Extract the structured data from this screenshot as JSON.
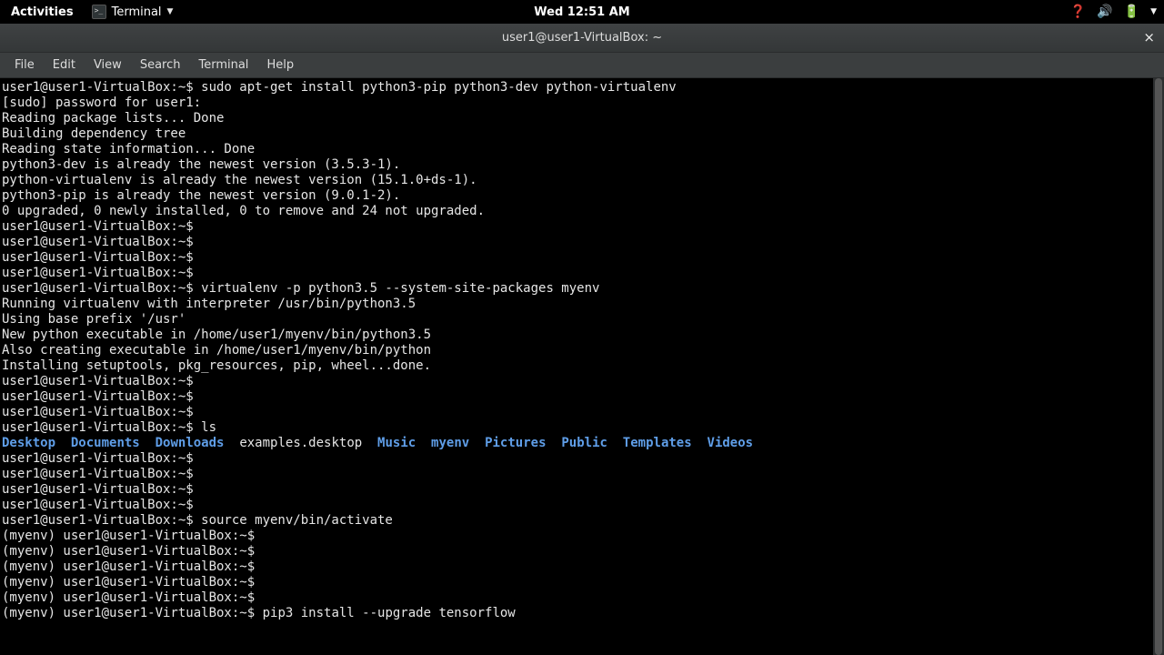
{
  "topbar": {
    "activities": "Activities",
    "app_label": "Terminal",
    "clock": "Wed 12:51 AM"
  },
  "window": {
    "title": "user1@user1-VirtualBox: ~"
  },
  "menubar": {
    "items": [
      "File",
      "Edit",
      "View",
      "Search",
      "Terminal",
      "Help"
    ]
  },
  "prompt": "user1@user1-VirtualBox:~$",
  "prompt_venv": "(myenv) user1@user1-VirtualBox:~$",
  "lines": [
    {
      "p": "prompt",
      "cmd": " sudo apt-get install python3-pip python3-dev python-virtualenv"
    },
    {
      "out": "[sudo] password for user1: "
    },
    {
      "out": "Reading package lists... Done"
    },
    {
      "out": "Building dependency tree"
    },
    {
      "out": "Reading state information... Done"
    },
    {
      "out": "python3-dev is already the newest version (3.5.3-1)."
    },
    {
      "out": "python-virtualenv is already the newest version (15.1.0+ds-1)."
    },
    {
      "out": "python3-pip is already the newest version (9.0.1-2)."
    },
    {
      "out": "0 upgraded, 0 newly installed, 0 to remove and 24 not upgraded."
    },
    {
      "p": "prompt",
      "cmd": " "
    },
    {
      "p": "prompt",
      "cmd": " "
    },
    {
      "p": "prompt",
      "cmd": " "
    },
    {
      "p": "prompt",
      "cmd": " "
    },
    {
      "p": "prompt",
      "cmd": " virtualenv -p python3.5 --system-site-packages myenv"
    },
    {
      "out": "Running virtualenv with interpreter /usr/bin/python3.5"
    },
    {
      "out": "Using base prefix '/usr'"
    },
    {
      "out": "New python executable in /home/user1/myenv/bin/python3.5"
    },
    {
      "out": "Also creating executable in /home/user1/myenv/bin/python"
    },
    {
      "out": "Installing setuptools, pkg_resources, pip, wheel...done."
    },
    {
      "p": "prompt",
      "cmd": " "
    },
    {
      "p": "prompt",
      "cmd": " "
    },
    {
      "p": "prompt",
      "cmd": " "
    },
    {
      "p": "prompt",
      "cmd": " ls"
    }
  ],
  "ls": {
    "entries": [
      {
        "name": "Desktop",
        "type": "dir"
      },
      {
        "name": "Documents",
        "type": "dir"
      },
      {
        "name": "Downloads",
        "type": "dir"
      },
      {
        "name": "examples.desktop",
        "type": "file"
      },
      {
        "name": "Music",
        "type": "dir"
      },
      {
        "name": "myenv",
        "type": "dir"
      },
      {
        "name": "Pictures",
        "type": "dir"
      },
      {
        "name": "Public",
        "type": "dir"
      },
      {
        "name": "Templates",
        "type": "dir"
      },
      {
        "name": "Videos",
        "type": "dir"
      }
    ]
  },
  "after_ls": [
    {
      "p": "prompt",
      "cmd": " "
    },
    {
      "p": "prompt",
      "cmd": " "
    },
    {
      "p": "prompt",
      "cmd": " "
    },
    {
      "p": "prompt",
      "cmd": " "
    },
    {
      "p": "prompt",
      "cmd": " source myenv/bin/activate"
    },
    {
      "p": "prompt_venv",
      "cmd": " "
    },
    {
      "p": "prompt_venv",
      "cmd": " "
    },
    {
      "p": "prompt_venv",
      "cmd": " "
    },
    {
      "p": "prompt_venv",
      "cmd": " "
    },
    {
      "p": "prompt_venv",
      "cmd": " "
    },
    {
      "p": "prompt_venv",
      "cmd": " pip3 install --upgrade tensorflow"
    }
  ]
}
